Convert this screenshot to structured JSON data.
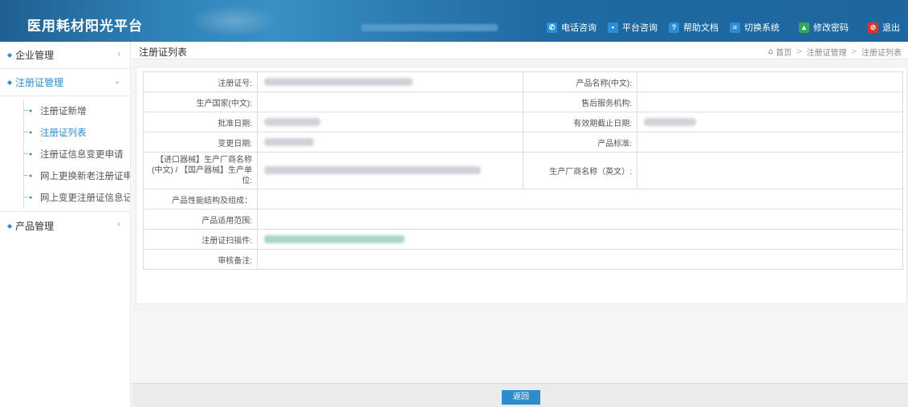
{
  "header": {
    "logo": "医用耗材阳光平台",
    "menu": [
      {
        "label": "电话咨询",
        "icon": "phone-icon",
        "color": "#2a8fd8",
        "glyph": "✆"
      },
      {
        "label": "平台咨询",
        "icon": "chat-icon",
        "color": "#2a8fd8",
        "glyph": "▪"
      },
      {
        "label": "帮助文档",
        "icon": "help-icon",
        "color": "#2a8fd8",
        "glyph": "?"
      },
      {
        "label": "切换系统",
        "icon": "switch-icon",
        "color": "#2a8fd8",
        "glyph": "≡"
      },
      {
        "label": "修改密码",
        "icon": "lock-icon",
        "color": "#2eaa5a",
        "glyph": "▲"
      },
      {
        "label": "退出",
        "icon": "logout-icon",
        "color": "#e0322a",
        "glyph": "⊘"
      }
    ]
  },
  "sidebar": {
    "groups": [
      {
        "label": "企业管理",
        "chevron": "‹"
      },
      {
        "label": "注册证管理",
        "chevron": "⌄",
        "sub": [
          "注册证新增",
          "注册证列表",
          "注册证信息变更申请",
          "网上更换新老注册证申",
          "网上变更注册证信息记"
        ]
      },
      {
        "label": "产品管理",
        "chevron": "‹"
      }
    ]
  },
  "main": {
    "title": "注册证列表",
    "breadcrumb": {
      "home": "首页",
      "level1": "注册证管理",
      "level2": "注册证列表",
      "sep": ">"
    },
    "fields": {
      "reg_no": "注册证号:",
      "product_name_cn": "产品名称(中文):",
      "country_cn": "生产国家(中文):",
      "service_org": "售后服务机构:",
      "approve_date": "批准日期:",
      "expire_date": "有效期截止日期:",
      "change_date": "变更日期:",
      "product_std": "产品标准:",
      "manufacturer_cn": "【进口器械】生产厂商名称(中文) / 【国产器械】生产单位:",
      "manufacturer_en": "生产厂商名称（英文）:",
      "structure": "产品性能结构及组成：",
      "scope": "产品适用范围:",
      "scan": "注册证扫描件:",
      "audit_note": "审核备注:"
    },
    "back_button": "返回"
  }
}
